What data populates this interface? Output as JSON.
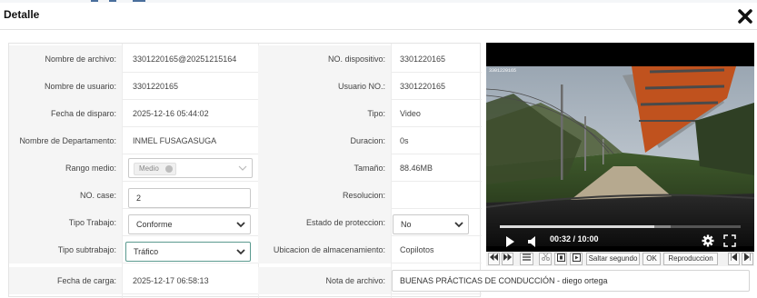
{
  "dialog": {
    "title": "Detalle",
    "close_icon": "close-x-icon"
  },
  "left_fields": [
    {
      "label": "Nombre de archivo:",
      "value": "3301220165@20251215164"
    },
    {
      "label": "Nombre de usuario:",
      "value": "3301220165"
    },
    {
      "label": "Fecha de disparo:",
      "value": "2025-12-16 05:44:02"
    },
    {
      "label": "Nombre de Departamento:",
      "value": "INMEL FUSAGASUGA"
    },
    {
      "label": "Rango medio:",
      "value": "Medio"
    },
    {
      "label": "NO. case:",
      "value": "2"
    },
    {
      "label": "Tipo Trabajo:",
      "value": "Conforme"
    },
    {
      "label": "Tipo subtrabajo:",
      "value": "Tráfico"
    },
    {
      "label": "Fecha de carga:",
      "value": "2025-12-17 06:58:13"
    }
  ],
  "right_fields": [
    {
      "label": "NO. dispositivo:",
      "value": "3301220165"
    },
    {
      "label": "Usuario NO.:",
      "value": "3301220165"
    },
    {
      "label": "Tipo:",
      "value": "Video"
    },
    {
      "label": "Duracion:",
      "value": "0s"
    },
    {
      "label": "Tamaño:",
      "value": "88.46MB"
    },
    {
      "label": "Resolucion:",
      "value": ""
    },
    {
      "label": "Estado de proteccion:",
      "value": "No"
    },
    {
      "label": "Ubicacion de almacenamiento:",
      "value": "Copilotos"
    },
    {
      "label": "Nota de archivo:",
      "value": "BUENAS PRÁCTICAS DE CONDUCCIÓN - diego ortega"
    }
  ],
  "player": {
    "overlay_text": "3301220165",
    "current_time": "00:32",
    "total_time": "10:00",
    "time_display": "00:32 / 10:00",
    "progress_fraction": 0.64,
    "icons": [
      "play-icon",
      "volume-icon",
      "settings-gear-icon",
      "fullscreen-icon"
    ]
  },
  "toolbar": {
    "skip_label": "Saltar segundo",
    "ok_label": "OK",
    "playback_label": "Reproduccion",
    "icons": [
      "rewind-icon",
      "fast-forward-icon",
      "list-icon",
      "scissors-icon",
      "frame-back-icon",
      "frame-forward-icon",
      "skip-start-icon",
      "skip-end-icon"
    ]
  },
  "colors": {
    "accent": "#5b9a8f",
    "label_bg": "#f5f5f5",
    "player_bg": "#000000"
  }
}
